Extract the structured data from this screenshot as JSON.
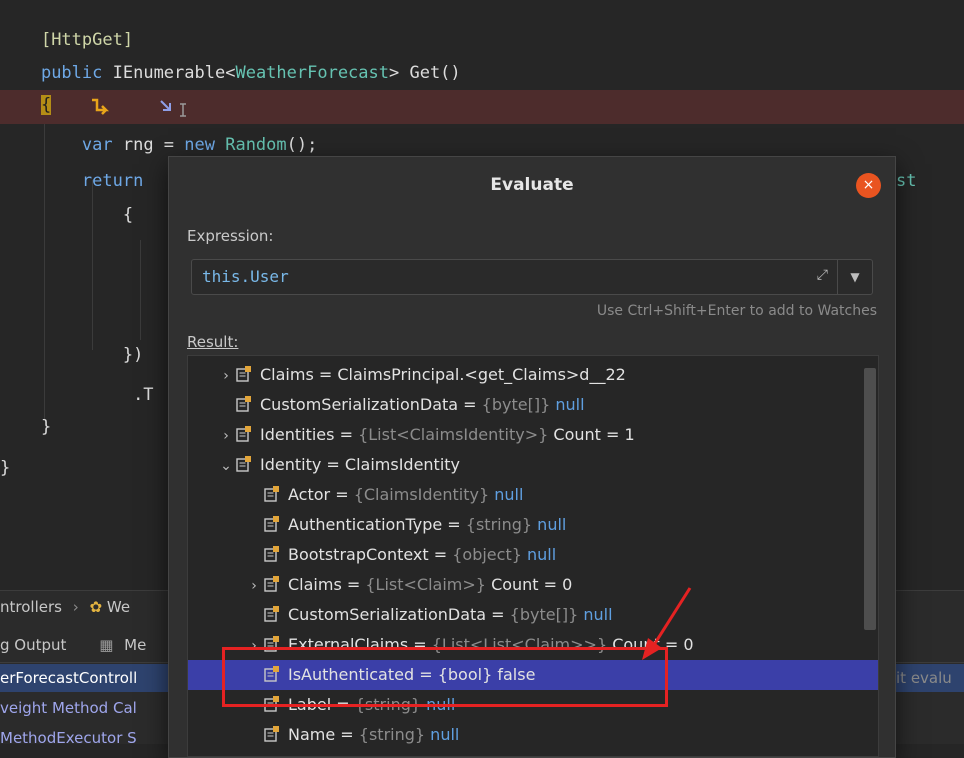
{
  "code": {
    "l1_attr": "[HttpGet]",
    "l2_kw": "public",
    "l2_type1": "IEnumerable",
    "l2_lt": "<",
    "l2_type2": "WeatherForecast",
    "l2_rest": "> Get()",
    "l3_brace": "{",
    "l4_kw": "var",
    "l4_rest1": " rng = ",
    "l4_kw2": "new",
    "l4_type": " Random",
    "l4_rest2": "();",
    "l5_kw": "return",
    "l5_right": "st",
    "l6": "{",
    "l7": "})",
    "l8": ".T",
    "l9": "}",
    "l10": "}"
  },
  "bottom": {
    "breadcrumb1": "ntrollers",
    "breadcrumb_sep": "›",
    "breadcrumb2": "We",
    "tab1": "g Output",
    "tab2": "Me",
    "row1": "erForecastControll",
    "row2": "veight Method Cal",
    "row3": "MethodExecutor S",
    "right_text": "it evalu"
  },
  "dialog": {
    "title": "Evaluate",
    "close": "×",
    "expression_label": "Expression:",
    "expression_value": "this.User",
    "hint": "Use Ctrl+Shift+Enter to add to Watches",
    "result_label": "Result:"
  },
  "tree": [
    {
      "arrow": "›",
      "name": "Claims",
      "eq": " = ",
      "type": "",
      "value": "ClaimsPrincipal.<get_Claims>d__22"
    },
    {
      "arrow": "",
      "name": "CustomSerializationData",
      "eq": " = ",
      "type": "{byte[]}",
      "value": "null"
    },
    {
      "arrow": "›",
      "name": "Identities",
      "eq": " = ",
      "type": "{List<ClaimsIdentity>}",
      "value": "Count = 1"
    },
    {
      "arrow": "⌄",
      "name": "Identity",
      "eq": " = ",
      "type": "",
      "value": "ClaimsIdentity"
    },
    {
      "arrow": "",
      "name": "Actor",
      "eq": " = ",
      "type": "{ClaimsIdentity}",
      "value": "null"
    },
    {
      "arrow": "",
      "name": "AuthenticationType",
      "eq": " = ",
      "type": "{string}",
      "value": "null"
    },
    {
      "arrow": "",
      "name": "BootstrapContext",
      "eq": " = ",
      "type": "{object}",
      "value": "null"
    },
    {
      "arrow": "›",
      "name": "Claims",
      "eq": " = ",
      "type": "{List<Claim>}",
      "value": "Count = 0"
    },
    {
      "arrow": "",
      "name": "CustomSerializationData",
      "eq": " = ",
      "type": "{byte[]}",
      "value": "null"
    },
    {
      "arrow": "›",
      "name": "ExternalClaims",
      "eq": " = ",
      "type": "{List<List<Claim>>}",
      "value": "Count = 0"
    },
    {
      "arrow": "",
      "name": "IsAuthenticated",
      "eq": " = ",
      "type": "{bool}",
      "value": "false"
    },
    {
      "arrow": "",
      "name": "Label",
      "eq": " = ",
      "type": "{string}",
      "value": "null"
    },
    {
      "arrow": "",
      "name": "Name",
      "eq": " = ",
      "type": "{string}",
      "value": "null"
    }
  ],
  "colors": {
    "accent": "#e95420",
    "selection": "#3b3fa8",
    "annotation": "#e52222"
  }
}
